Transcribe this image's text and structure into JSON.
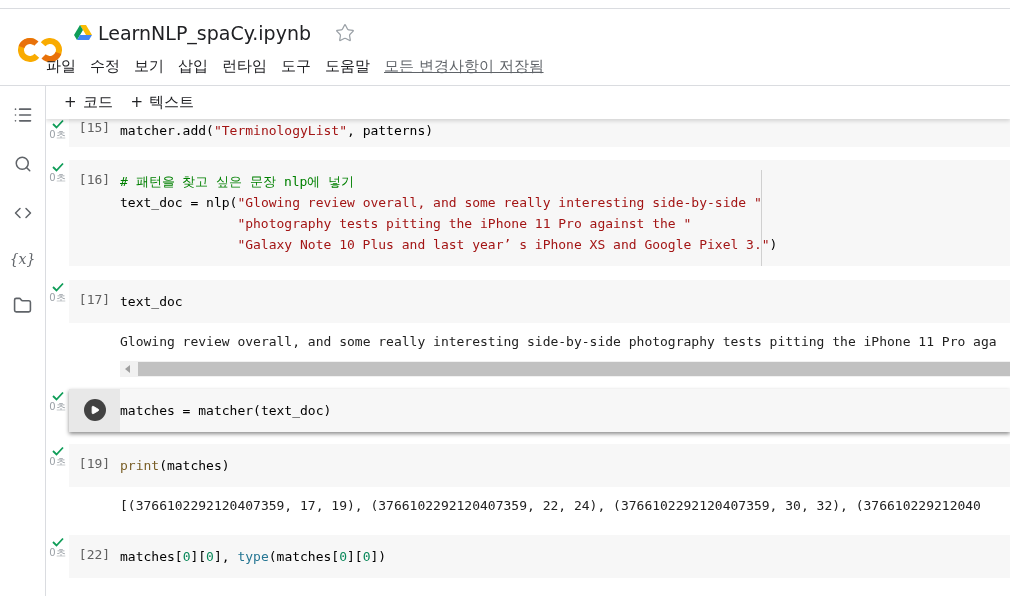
{
  "notebook": {
    "title": "LearnNLP_spaCy.ipynb",
    "starred": false
  },
  "menu": [
    {
      "label": "파일"
    },
    {
      "label": "수정"
    },
    {
      "label": "보기"
    },
    {
      "label": "삽입"
    },
    {
      "label": "런타임"
    },
    {
      "label": "도구"
    },
    {
      "label": "도움말"
    }
  ],
  "save_status": "모든 변경사항이 저장됨",
  "toolbar": [
    {
      "icon": "+",
      "label": "코드"
    },
    {
      "icon": "+",
      "label": "텍스트"
    }
  ],
  "sidebar": {
    "variables_label": "{x}"
  },
  "cells": [
    {
      "count": "[15]",
      "time": "0초",
      "focused": false,
      "lines": [
        {
          "continuation": false,
          "tokens": [
            {
              "kind": "plain",
              "text": "matcher.add("
            },
            {
              "kind": "string",
              "text": "\"TerminologyList\""
            },
            {
              "kind": "plain",
              "text": ", patterns)"
            }
          ]
        }
      ]
    },
    {
      "count": "[16]",
      "time": "0초",
      "focused": false,
      "ruler": true,
      "lines": [
        {
          "continuation": false,
          "tokens": [
            {
              "kind": "comment",
              "text": "# 패턴을 찾고 싶은 문장 nlp에 넣기"
            }
          ]
        },
        {
          "continuation": false,
          "tokens": [
            {
              "kind": "plain",
              "text": "text_doc = nlp("
            },
            {
              "kind": "string",
              "text": "\"Glowing review overall, and some really interesting side-by-side \""
            }
          ]
        },
        {
          "continuation": true,
          "tokens": [
            {
              "kind": "string",
              "text": "\"photography tests pitting the iPhone 11 Pro against the \""
            }
          ]
        },
        {
          "continuation": true,
          "tokens": [
            {
              "kind": "string",
              "text": "\"Galaxy Note 10 Plus and last year’ s iPhone XS and Google Pixel 3.\""
            },
            {
              "kind": "plain",
              "text": ")"
            }
          ]
        }
      ]
    },
    {
      "count": "[17]",
      "time": "0초",
      "focused": false,
      "lines": [
        {
          "continuation": false,
          "tokens": [
            {
              "kind": "plain",
              "text": "text_doc"
            }
          ]
        }
      ],
      "output": "Glowing review overall, and some really interesting side-by-side photography tests pitting the iPhone 11 Pro aga",
      "output_scroll": true
    },
    {
      "time": "0초",
      "focused": true,
      "lines": [
        {
          "continuation": false,
          "tokens": [
            {
              "kind": "plain",
              "text": "matches = matcher(text_doc)"
            }
          ]
        }
      ]
    },
    {
      "count": "[19]",
      "time": "0초",
      "focused": false,
      "lines": [
        {
          "continuation": false,
          "tokens": [
            {
              "kind": "builtin",
              "text": "print"
            },
            {
              "kind": "plain",
              "text": "(matches)"
            }
          ]
        }
      ],
      "output": "[(3766102292120407359, 17, 19), (3766102292120407359, 22, 24), (3766102292120407359, 30, 32), (376610229212040"
    },
    {
      "count": "[22]",
      "time": "0초",
      "focused": false,
      "lines": [
        {
          "continuation": false,
          "tokens": [
            {
              "kind": "plain",
              "text": "matches["
            },
            {
              "kind": "number",
              "text": "0"
            },
            {
              "kind": "plain",
              "text": "]["
            },
            {
              "kind": "number",
              "text": "0"
            },
            {
              "kind": "plain",
              "text": "], "
            },
            {
              "kind": "builtin2",
              "text": "type"
            },
            {
              "kind": "plain",
              "text": "(matches["
            },
            {
              "kind": "number",
              "text": "0"
            },
            {
              "kind": "plain",
              "text": "]["
            },
            {
              "kind": "number",
              "text": "0"
            },
            {
              "kind": "plain",
              "text": "])"
            }
          ]
        }
      ]
    }
  ]
}
